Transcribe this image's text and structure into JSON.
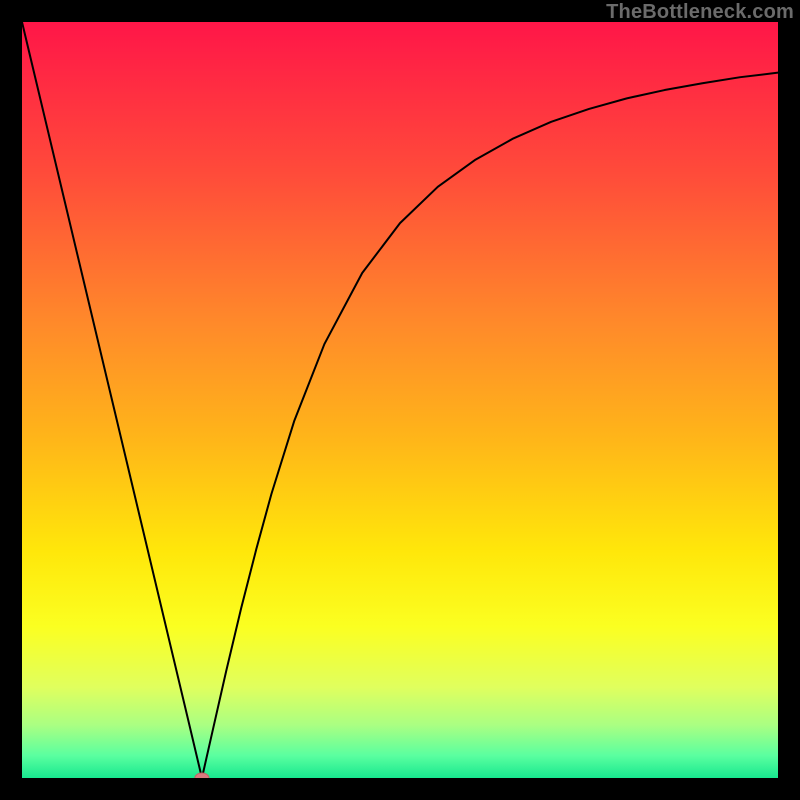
{
  "watermark": "TheBottleneck.com",
  "colors": {
    "frame": "#000000",
    "curve": "#000000",
    "marker_fill": "#d97a7f",
    "marker_stroke": "#c46267"
  },
  "gradient_stops": [
    {
      "offset": 0.0,
      "color": "#ff1648"
    },
    {
      "offset": 0.2,
      "color": "#ff4b3a"
    },
    {
      "offset": 0.4,
      "color": "#ff8a2a"
    },
    {
      "offset": 0.55,
      "color": "#ffb519"
    },
    {
      "offset": 0.7,
      "color": "#ffe70a"
    },
    {
      "offset": 0.8,
      "color": "#fbff21"
    },
    {
      "offset": 0.88,
      "color": "#e0ff5e"
    },
    {
      "offset": 0.93,
      "color": "#aaff82"
    },
    {
      "offset": 0.97,
      "color": "#5bffa0"
    },
    {
      "offset": 1.0,
      "color": "#17e88f"
    }
  ],
  "chart_data": {
    "type": "line",
    "title": "",
    "xlabel": "",
    "ylabel": "",
    "xlim": [
      0,
      100
    ],
    "ylim": [
      0,
      100
    ],
    "x": [
      0,
      2,
      4,
      6,
      8,
      10,
      12,
      14,
      16,
      18,
      20,
      22,
      23.8,
      25,
      27,
      29,
      31,
      33,
      36,
      40,
      45,
      50,
      55,
      60,
      65,
      70,
      75,
      80,
      85,
      90,
      95,
      100
    ],
    "y": [
      100,
      91.6,
      83.2,
      74.8,
      66.4,
      58.0,
      49.6,
      41.2,
      32.8,
      24.4,
      16.0,
      7.6,
      0.0,
      5.3,
      14.1,
      22.5,
      30.3,
      37.6,
      47.2,
      57.4,
      66.8,
      73.4,
      78.2,
      81.8,
      84.6,
      86.8,
      88.5,
      89.9,
      91.0,
      91.9,
      92.7,
      93.3
    ],
    "marker": {
      "x_pct": 23.8,
      "y_pct": 0.0
    }
  }
}
